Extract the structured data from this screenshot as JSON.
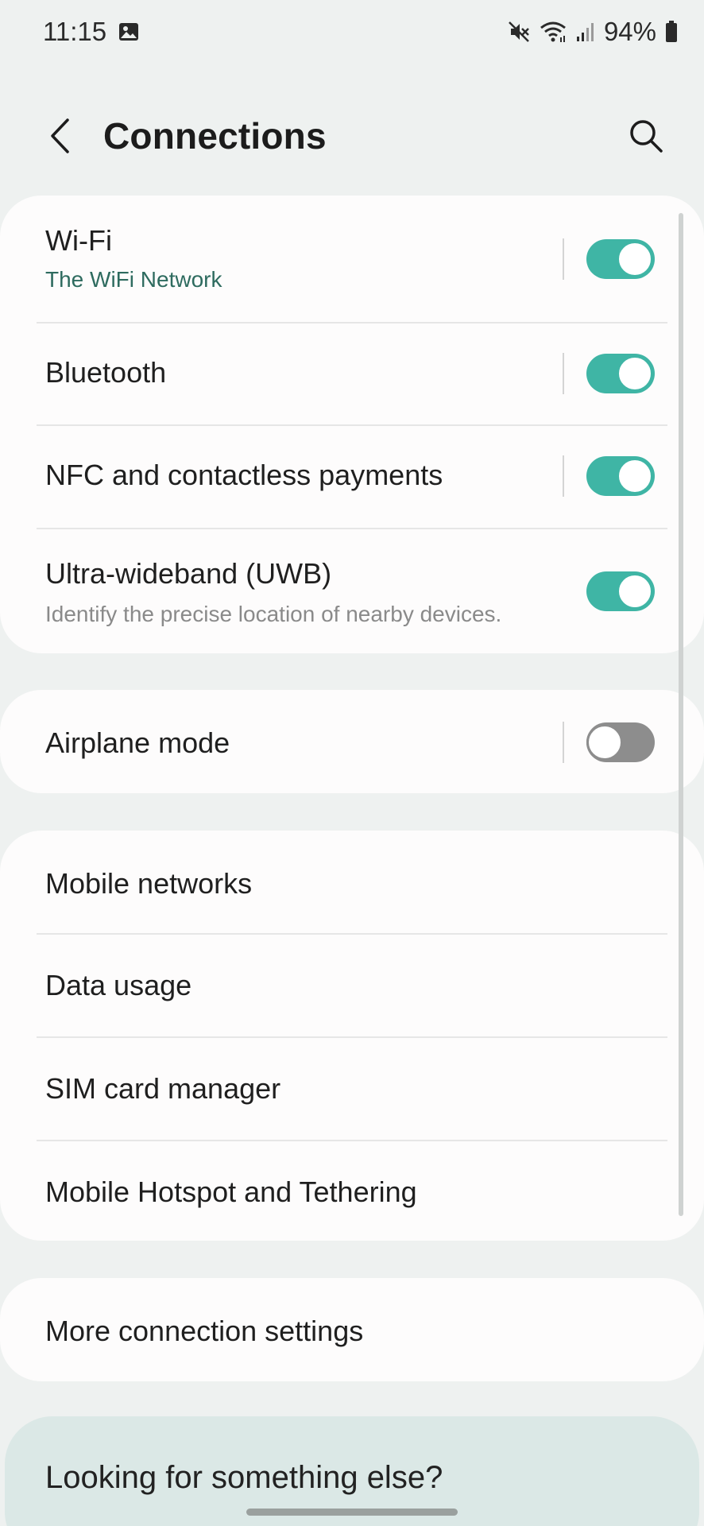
{
  "status_bar": {
    "time": "11:15",
    "battery": "94%",
    "icons": [
      "gallery-icon",
      "mute-icon",
      "wifi-icon",
      "signal-icon",
      "battery-icon"
    ]
  },
  "header": {
    "title": "Connections",
    "back_icon": "chevron-left-icon",
    "search_icon": "search-icon"
  },
  "colors": {
    "toggle_on": "#3fb5a5",
    "toggle_off": "#8d8d8d",
    "accent_text": "#2e6b5f",
    "background": "#eef1f0",
    "card": "#fdfcfc",
    "help_card": "#dbe8e6"
  },
  "groups": {
    "radios": [
      {
        "title": "Wi-Fi",
        "subtitle": "The WiFi Network",
        "toggle": true
      },
      {
        "title": "Bluetooth",
        "toggle": true
      },
      {
        "title": "NFC and contactless payments",
        "toggle": true
      },
      {
        "title": "Ultra-wideband (UWB)",
        "subtitle": "Identify the precise location of nearby devices.",
        "toggle": true
      }
    ],
    "airplane": {
      "title": "Airplane mode",
      "toggle": false
    },
    "networks": [
      {
        "title": "Mobile networks"
      },
      {
        "title": "Data usage"
      },
      {
        "title": "SIM card manager"
      },
      {
        "title": "Mobile Hotspot and Tethering"
      }
    ],
    "more": {
      "title": "More connection settings"
    }
  },
  "help": {
    "title": "Looking for something else?"
  }
}
